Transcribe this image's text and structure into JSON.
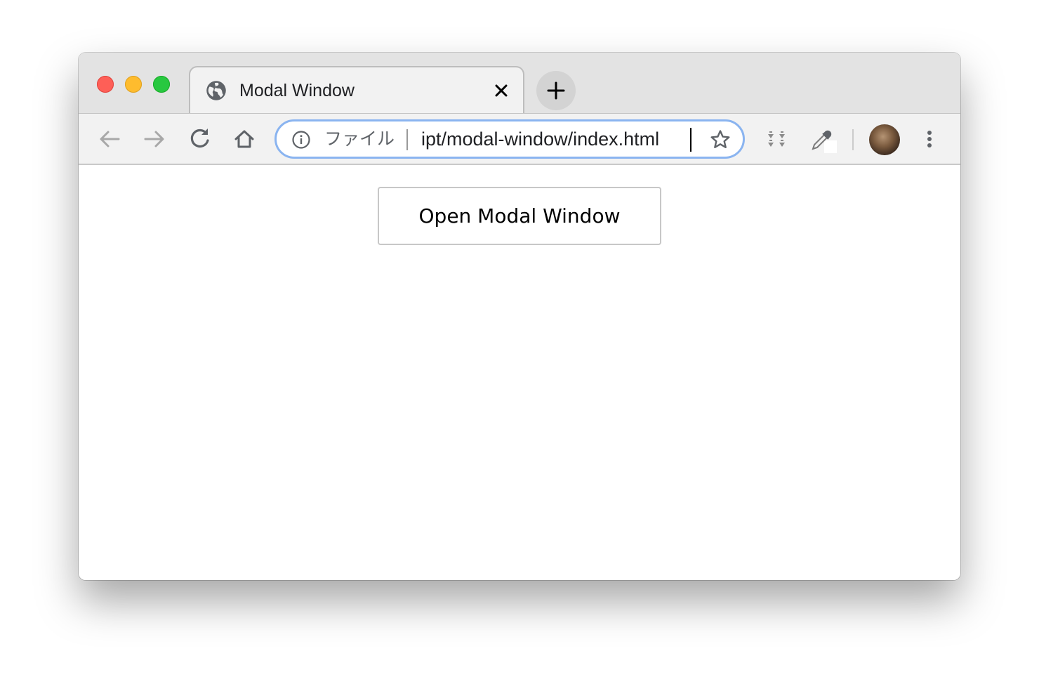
{
  "window": {
    "tab_title": "Modal Window"
  },
  "omnibox": {
    "scheme_chip": "ファイル",
    "url": "ipt/modal-window/index.html"
  },
  "icons": {
    "tab_favicon": "globe-icon",
    "tab_close": "close-icon",
    "new_tab": "plus-icon",
    "back": "arrow-left-icon",
    "forward": "arrow-right-icon",
    "reload": "reload-icon",
    "home": "home-icon",
    "site_info": "info-icon",
    "bookmark": "star-icon",
    "extension_1": "extension-icon",
    "extension_2": "eyedropper-icon",
    "menu": "more-vert-icon"
  },
  "colors": {
    "close_light": "#fe5f57",
    "minimize_light": "#febc2e",
    "zoom_light": "#28c840",
    "omnibox_focus": "#8ab4f0"
  },
  "page": {
    "open_button_label": "Open Modal Window"
  }
}
